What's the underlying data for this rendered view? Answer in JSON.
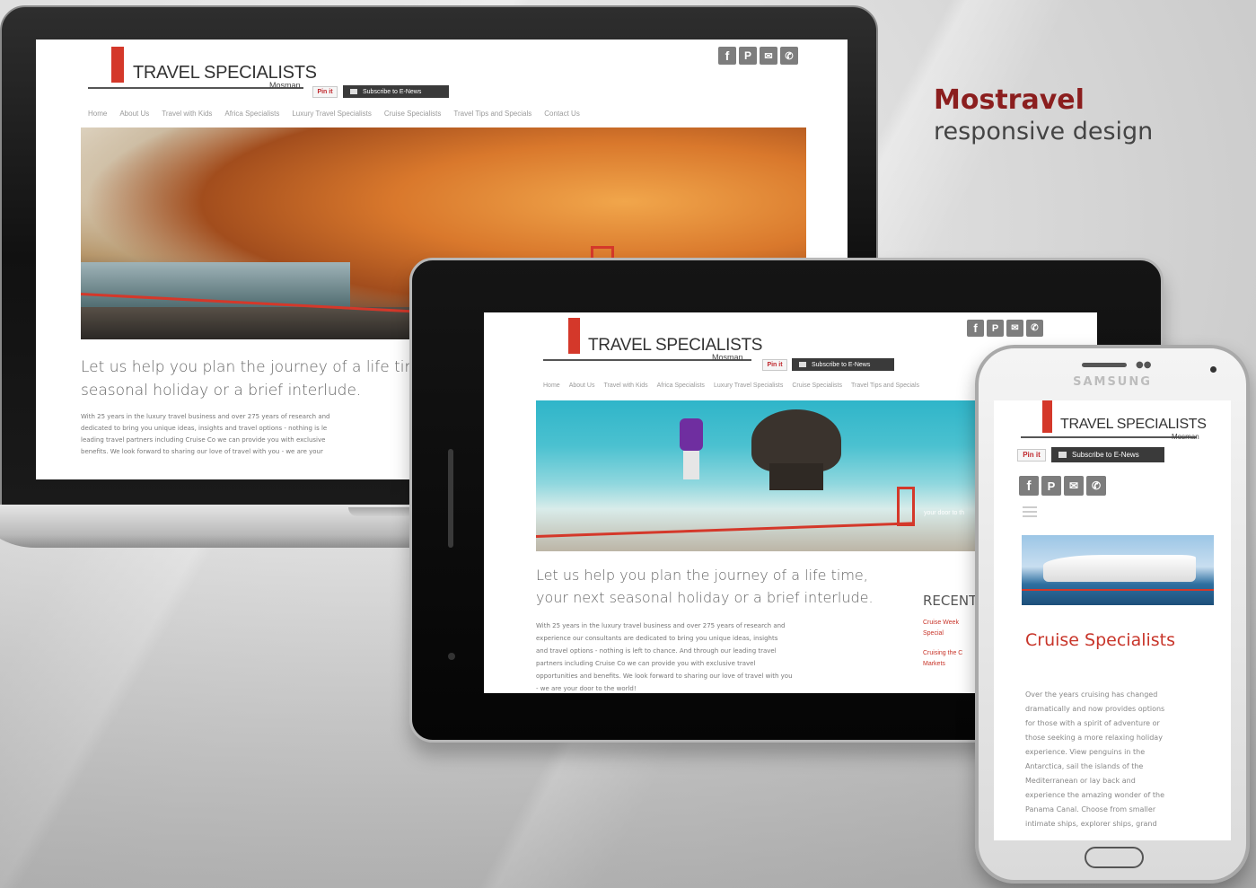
{
  "headline": {
    "brand": "Mostravel",
    "subtitle": "responsive design"
  },
  "site": {
    "logo_title": "TRAVEL SPECIALISTS",
    "logo_sub": "Mosman",
    "pin_label": "Pin it",
    "subscribe_label": "Subscribe to E-News",
    "social_icons": [
      "facebook-icon",
      "pinterest-icon",
      "email-icon",
      "phone-icon"
    ],
    "nav": [
      "Home",
      "About Us",
      "Travel with Kids",
      "Africa Specialists",
      "Luxury Travel Specialists",
      "Cruise Specialists",
      "Travel Tips and Specials",
      "Contact Us"
    ],
    "intro_line1": "Let us help you plan the journey of a life time,",
    "intro_line2": "your next seasonal holiday or a brief interlude.",
    "body": "With 25 years in the luxury travel business and over 275 years of research and experience our consultants are dedicated to bring you unique ideas, insights and travel options - nothing is left to chance. And through our leading travel partners including Cruise Co we can provide you with exclusive travel opportunities and benefits. We look forward to sharing our love of travel with you - we are your door to the world!",
    "accent": "#d4382a"
  },
  "laptop": {
    "intro_line1": "Let us help you plan the journey of a life time",
    "intro_line2": "seasonal holiday or a brief interlude.",
    "body_lines": [
      "With 25 years in the luxury travel business and over 275 years of research and",
      "dedicated to bring you unique ideas, insights and travel options - nothing is le",
      "leading travel partners including Cruise Co we can provide you with exclusive",
      "benefits. We look forward to sharing our love of travel with you - we are your"
    ]
  },
  "tablet": {
    "hero_caption": "your door to th",
    "body_lines": [
      "With 25 years in the luxury travel business and over 275 years of research and",
      "experience our consultants are dedicated to bring you unique ideas, insights",
      "and travel options - nothing is left to chance. And through our leading travel",
      "partners including Cruise Co we can provide you with exclusive travel",
      "opportunities and benefits. We look forward to sharing our love of travel with you",
      "- we are your door to the world!"
    ],
    "recent_heading": "RECENT",
    "recent_links": [
      "Cruise Week",
      "Special",
      "Cruising the C",
      "Markets"
    ]
  },
  "phone": {
    "brand": "SAMSUNG",
    "heading": "Cruise Specialists",
    "body_lines": [
      "Over the years cruising has changed",
      "dramatically and now provides options",
      "for those with a spirit of adventure or",
      "those seeking a more relaxing holiday",
      "experience. View penguins in the",
      "Antarctica, sail the islands of the",
      "Mediterranean or lay back and",
      "experience the amazing wonder of the",
      "Panama Canal. Choose from smaller",
      "intimate ships, explorer ships, grand"
    ]
  }
}
